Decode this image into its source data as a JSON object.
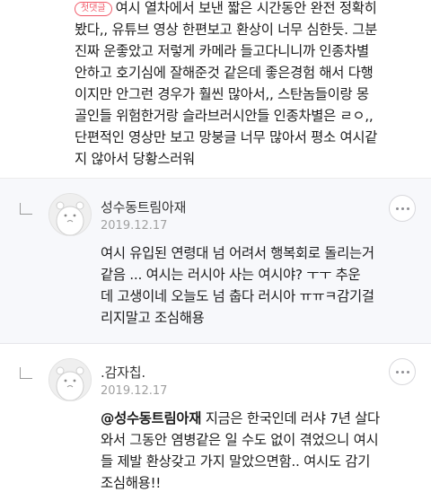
{
  "first_comment": {
    "badge": "첫댓글",
    "line1": "여시 열차에서 보낸 짧은 시간동안 완전 정확히",
    "rest": "봤다,, 유튜브 영상 한편보고 환상이 너무 심한듯. 그분\n진짜 운좋았고 저렇게 카메라 들고다니니까 인종차별\n안하고 호기심에 잘해준것 같은데 좋은경험 해서 다행\n이지만 안그런 경우가 훨씬 많아서,, 스탄놈들이랑 몽\n골인들 위험한거랑 슬라브러시안들 인종차별은 ㄹㅇ,,\n단편적인 영상만 보고 망붕글 너무 많아서 평소 여시같\n지 않아서 당황스러워"
  },
  "replies": [
    {
      "nickname": "성수동트림아재",
      "date": "2019.12.17",
      "text": "여시 유입된 연령대 넘 어려서 행복회로 돌리는거\n같음 ... 여시는 러시아 사는 여시야?  ㅜㅜ 추운\n데 고생이네 오늘도 넘 춥다 러시아 ㅠㅠㅋ감기걸\n리지말고 조심해용"
    },
    {
      "nickname": ".감자칩.",
      "date": "2019.12.17",
      "mention": "@성수동트림아재",
      "text": "  지금은 한국인데 러샤 7년 살다\n와서 그동안 염병같은 일 수도 없이 겪었으니 여시\n들 제발 환상갖고 가지 말았으면함.. 여시도 감기\n조심해용!!"
    }
  ]
}
